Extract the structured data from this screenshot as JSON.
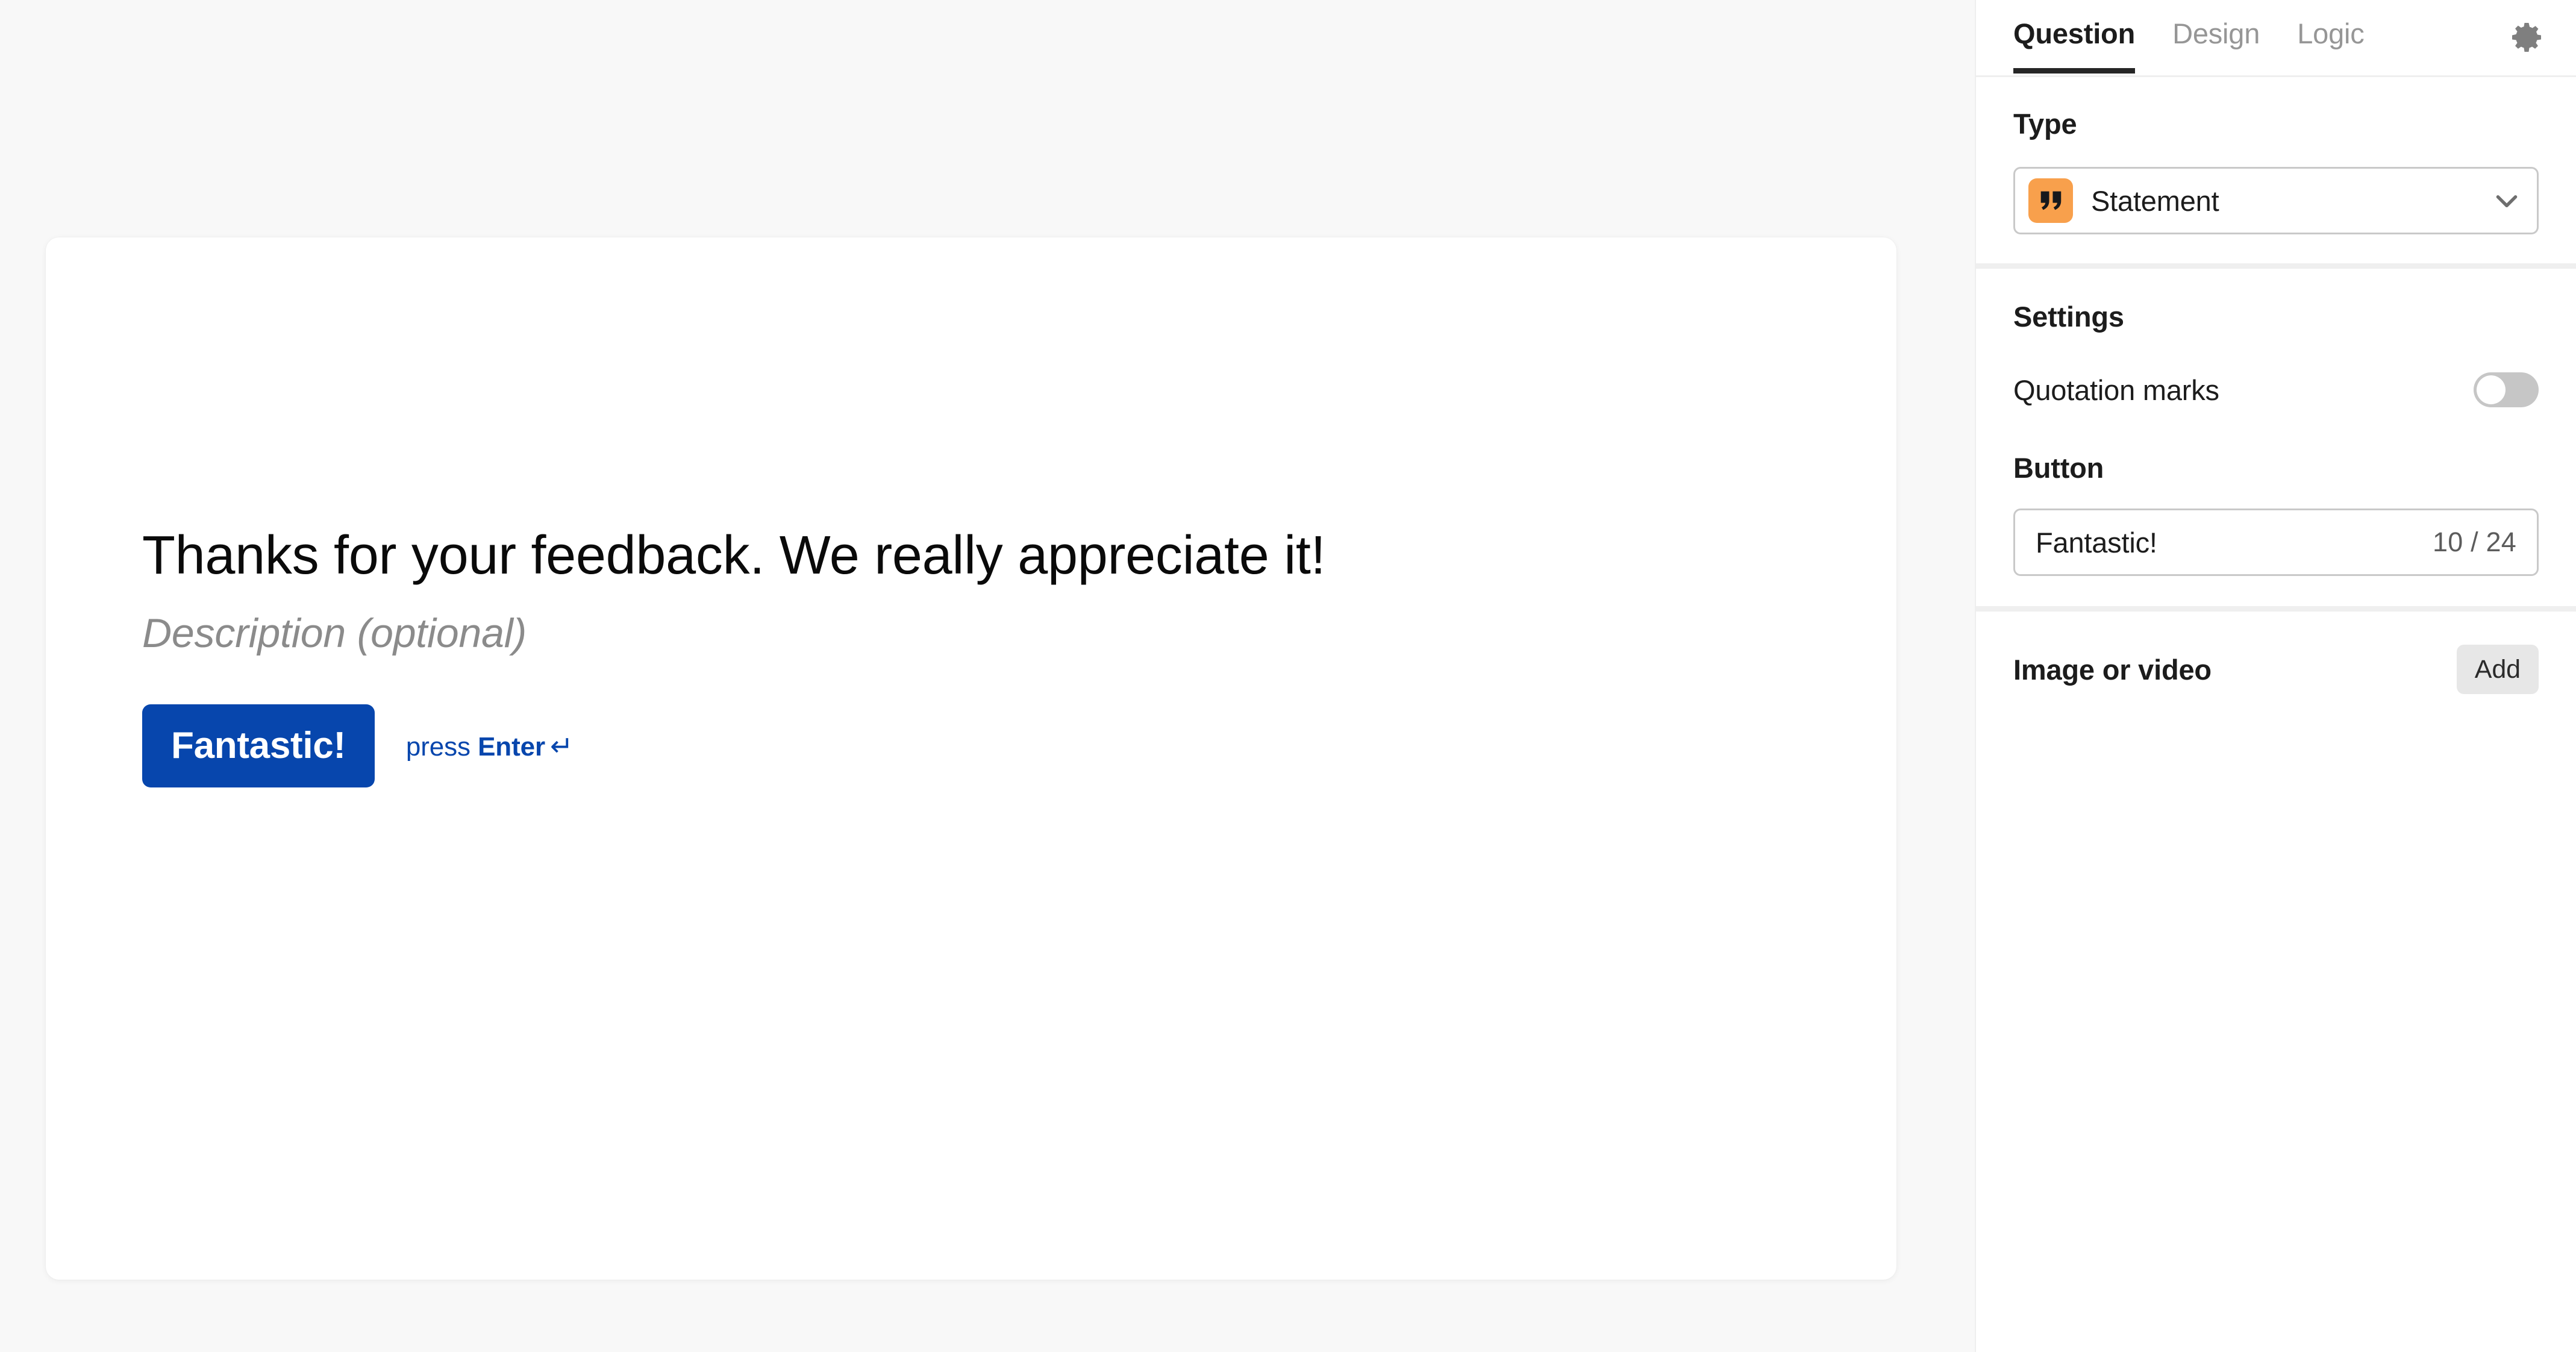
{
  "preview": {
    "headline": "Thanks for your feedback. We really appreciate it!",
    "description_placeholder": "Description (optional)",
    "cta_label": "Fantastic!",
    "enter_hint_prefix": "press ",
    "enter_hint_key": "Enter",
    "enter_hint_arrow": "↵"
  },
  "panel": {
    "tabs": [
      {
        "label": "Question",
        "active": true
      },
      {
        "label": "Design",
        "active": false
      },
      {
        "label": "Logic",
        "active": false
      }
    ],
    "settings_gear_icon": "gear-icon",
    "type": {
      "label": "Type",
      "selected": "Statement",
      "icon": "quotation-marks-icon",
      "icon_color": "#f8a04c",
      "chevron_icon": "chevron-down-icon"
    },
    "settings": {
      "label": "Settings",
      "quotation_marks": {
        "label": "Quotation marks",
        "value": "off"
      },
      "button": {
        "label": "Button",
        "value": "Fantastic!",
        "counter": "10 / 24"
      }
    },
    "media": {
      "label": "Image or video",
      "add_label": "Add"
    }
  },
  "colors": {
    "accent_blue": "#0746ad",
    "type_icon_orange": "#f8a04c",
    "canvas_bg": "#f8f8f8",
    "tab_active_underline": "#262626",
    "toggle_off": "#c6c6c6"
  }
}
